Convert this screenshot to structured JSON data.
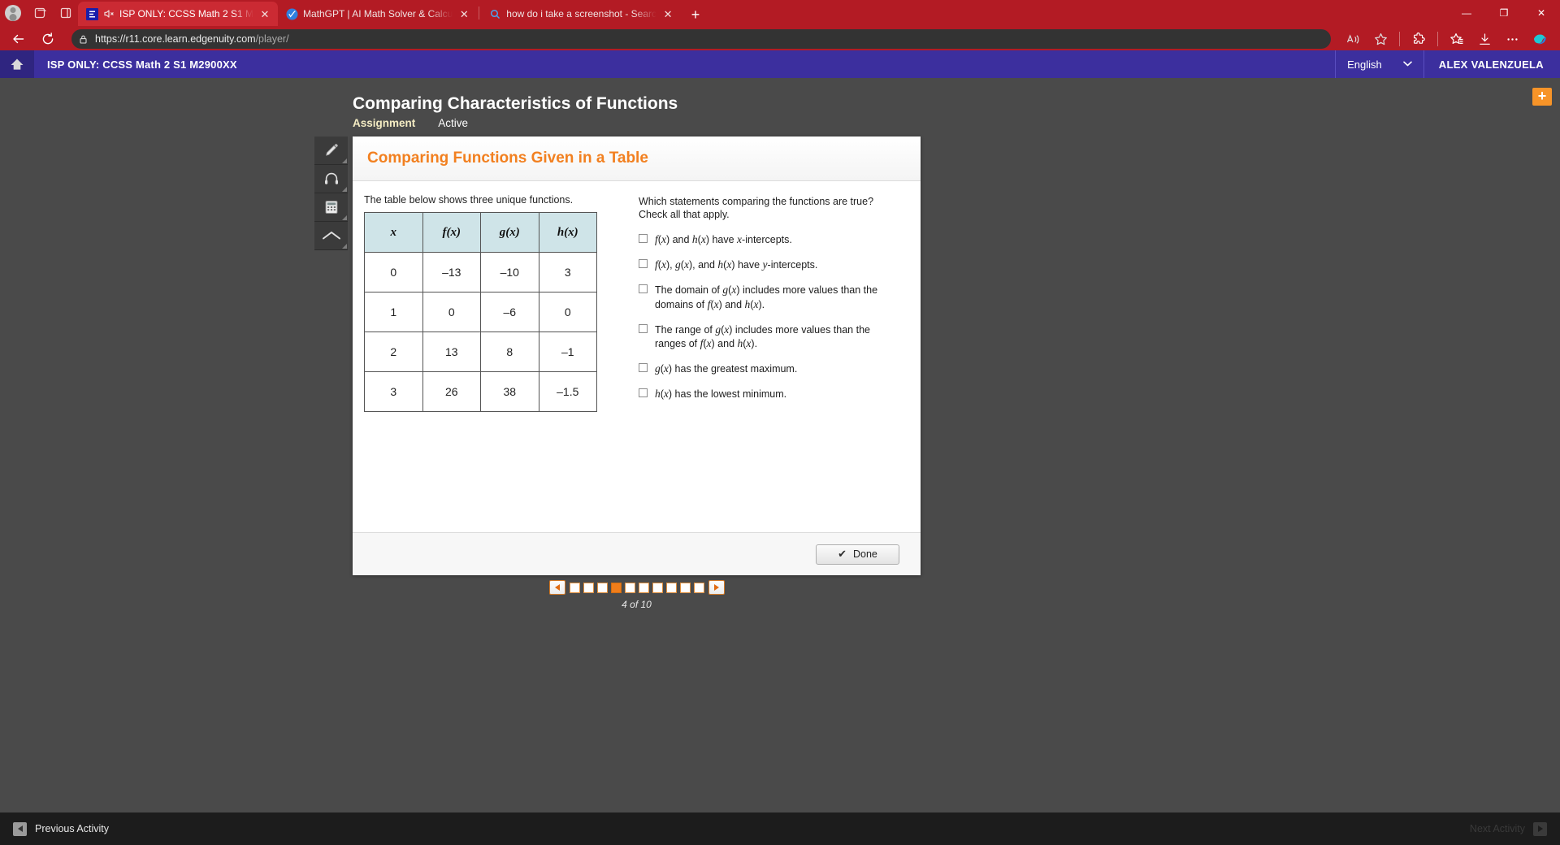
{
  "browser": {
    "tabs": [
      {
        "title": "ISP ONLY: CCSS Math 2 S1 M",
        "favicon": "edgenuity-icon",
        "muted": true,
        "active": true,
        "close_label": "✕"
      },
      {
        "title": "MathGPT | AI Math Solver & Calcu",
        "favicon": "mathgpt-icon",
        "muted": false,
        "active": false,
        "close_label": "✕"
      },
      {
        "title": "how do i take a screenshot - Searc",
        "favicon": "search-icon",
        "muted": false,
        "active": false,
        "close_label": "✕"
      }
    ],
    "new_tab_label": "+",
    "window_controls": {
      "minimize": "—",
      "maximize": "❐",
      "close": "✕"
    },
    "url": "https://r11.core.learn.edgenuity.com",
    "url_path": "/player/",
    "toolbar_icons": [
      "read-aloud-icon",
      "favorite-star-icon",
      "extensions-icon",
      "collections-icon",
      "downloads-icon",
      "settings-more-icon",
      "copilot-icon"
    ]
  },
  "header": {
    "home_icon": "home-icon",
    "course_title": "ISP ONLY: CCSS Math 2 S1 M2900XX",
    "language": "English",
    "language_caret": "⌄",
    "user_name": "ALEX VALENZUELA"
  },
  "stage": {
    "plus_button_label": "+",
    "lesson_title": "Comparing Characteristics of Functions",
    "sub_assignment": "Assignment",
    "sub_active": "Active"
  },
  "tools": [
    {
      "name": "pencil-icon",
      "label": "Pencil"
    },
    {
      "name": "headphones-icon",
      "label": "Audio"
    },
    {
      "name": "calculator-icon",
      "label": "Calculator"
    },
    {
      "name": "collapse-up-icon",
      "label": "Collapse"
    }
  ],
  "card": {
    "heading": "Comparing Functions Given in a Table",
    "intro_text": "The table below shows three unique functions.",
    "table": {
      "headers": [
        "x",
        "f(x)",
        "g(x)",
        "h(x)"
      ],
      "rows": [
        [
          "0",
          "–13",
          "–10",
          "3"
        ],
        [
          "1",
          "0",
          "–6",
          "0"
        ],
        [
          "2",
          "13",
          "8",
          "–1"
        ],
        [
          "3",
          "26",
          "38",
          "–1.5"
        ]
      ]
    },
    "question": "Which statements comparing the functions are true? Check all that apply.",
    "options": [
      {
        "checked": false,
        "text": "f(x) and h(x) have x-intercepts."
      },
      {
        "checked": false,
        "text": "f(x), g(x), and h(x) have y-intercepts."
      },
      {
        "checked": false,
        "text": "The domain of g(x) includes more values than the domains of f(x) and h(x)."
      },
      {
        "checked": false,
        "text": "The range of g(x) includes more values than the ranges of f(x) and h(x)."
      },
      {
        "checked": false,
        "text": "g(x) has the greatest maximum."
      },
      {
        "checked": false,
        "text": "h(x) has the lowest minimum."
      }
    ],
    "done_label": "Done",
    "done_check": "✔"
  },
  "pagination": {
    "prev_label": "◀",
    "next_label": "▶",
    "total_steps": 10,
    "current_step": 4,
    "count_label": "4 of 10"
  },
  "bottom_bar": {
    "previous_label": "Previous Activity",
    "next_label": "Next Activity"
  },
  "colors": {
    "browser_red": "#b31b24",
    "header_purple": "#3c2f9e",
    "stage_gray": "#4a4a4a",
    "accent_orange": "#f28020",
    "table_header_blue": "#cfe4e8"
  }
}
